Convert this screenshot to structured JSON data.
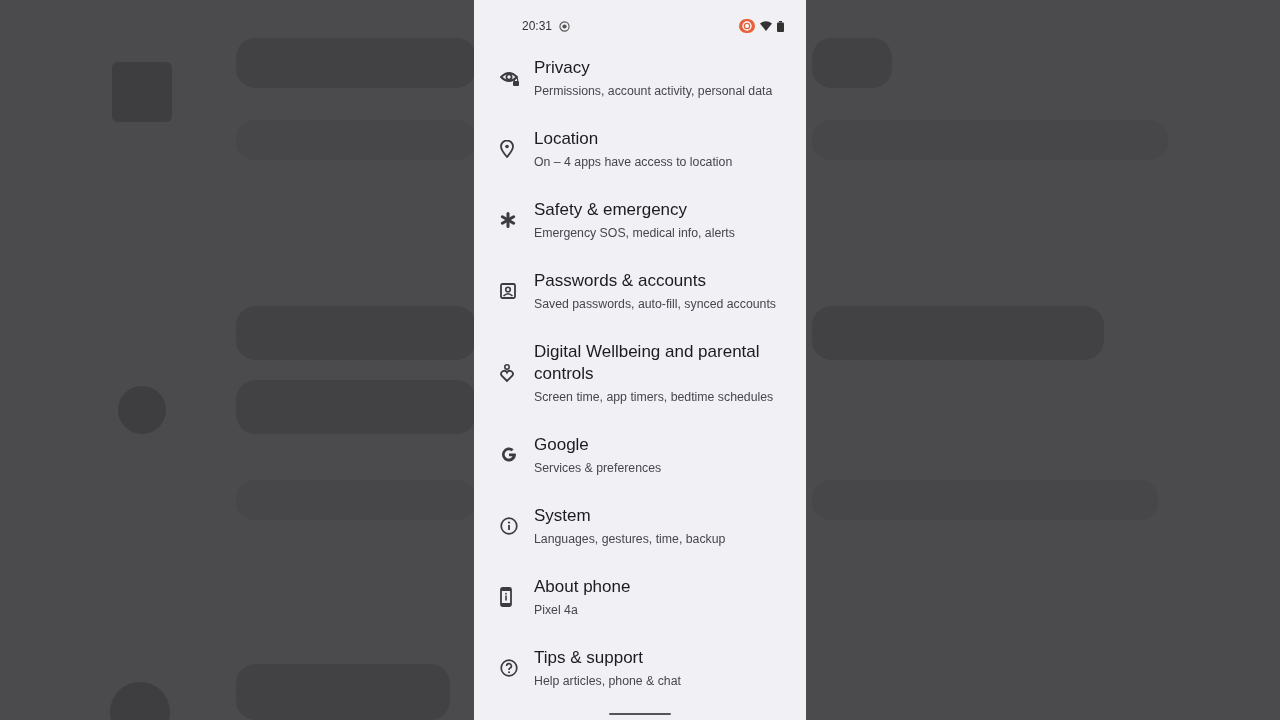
{
  "status_bar": {
    "time": "20:31",
    "recording": true
  },
  "settings": [
    {
      "kind": "privacy",
      "title": "Privacy",
      "subtitle": "Permissions, account activity, personal data"
    },
    {
      "kind": "location",
      "title": "Location",
      "subtitle": "On – 4 apps have access to location"
    },
    {
      "kind": "safety",
      "title": "Safety & emergency",
      "subtitle": "Emergency SOS, medical info, alerts"
    },
    {
      "kind": "passwords",
      "title": "Passwords & accounts",
      "subtitle": "Saved passwords, auto-fill, synced accounts"
    },
    {
      "kind": "wellbeing",
      "title": "Digital Wellbeing and parental controls",
      "subtitle": "Screen time, app timers, bedtime schedules"
    },
    {
      "kind": "google",
      "title": "Google",
      "subtitle": "Services & preferences"
    },
    {
      "kind": "system",
      "title": "System",
      "subtitle": "Languages, gestures, time, backup"
    },
    {
      "kind": "about",
      "title": "About phone",
      "subtitle": "Pixel 4a"
    },
    {
      "kind": "tips",
      "title": "Tips & support",
      "subtitle": "Help articles, phone & chat"
    }
  ]
}
